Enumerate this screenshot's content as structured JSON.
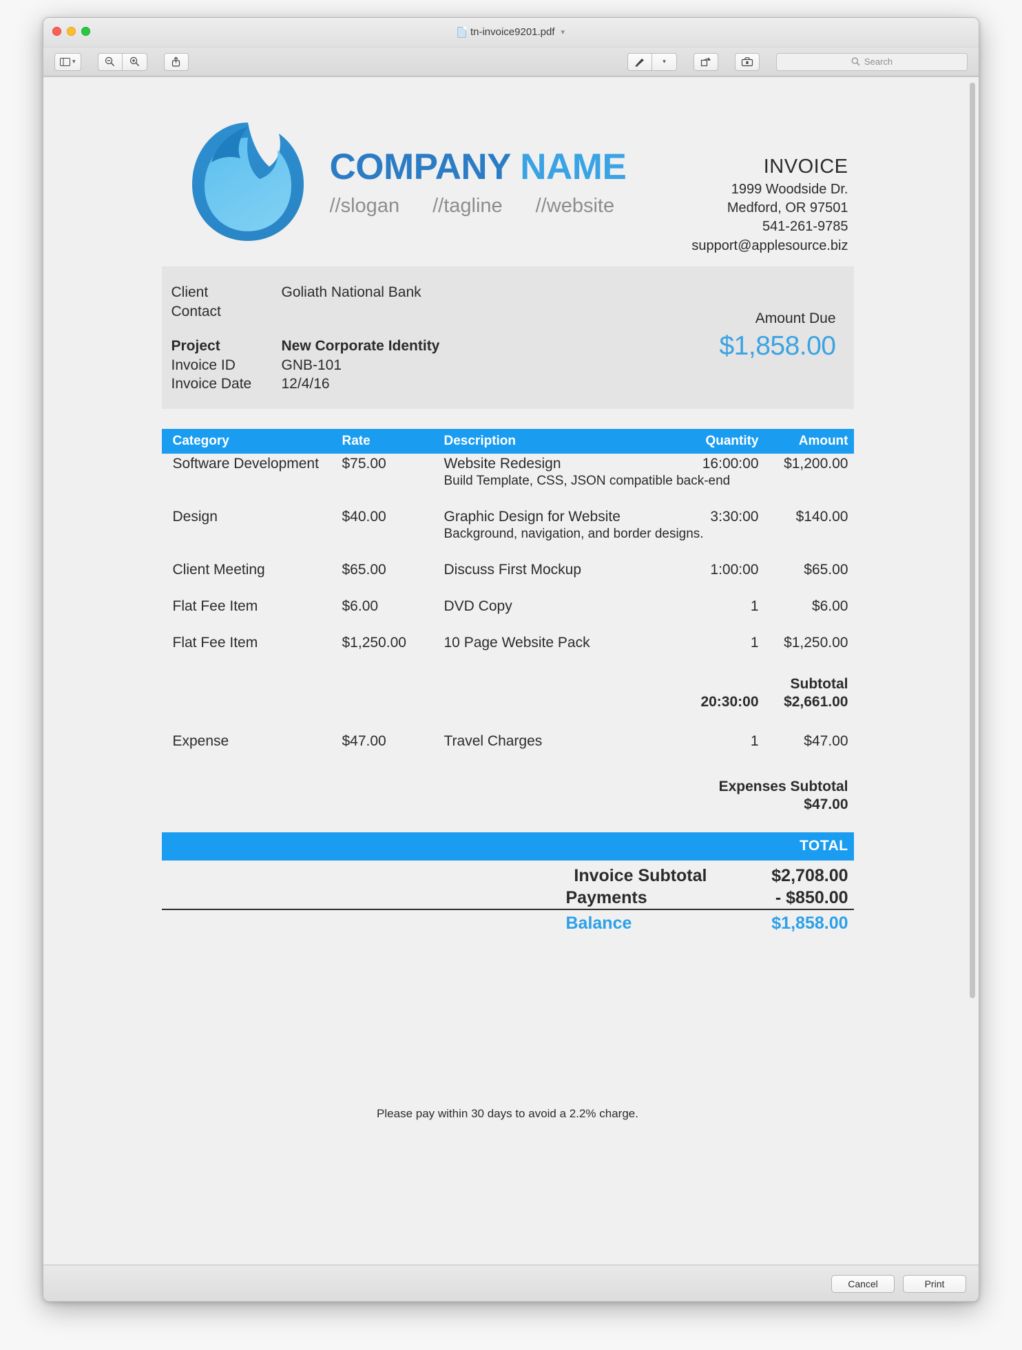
{
  "window": {
    "title": "tn-invoice9201.pdf",
    "traffic_lights": [
      "close",
      "minimize",
      "zoom"
    ]
  },
  "toolbar": {
    "sidebar_icon": "sidebar-icon",
    "zoom_out_icon": "zoom-out-icon",
    "zoom_in_icon": "zoom-in-icon",
    "share_icon": "share-icon",
    "markup_icon": "markup-pen-icon",
    "rotate_icon": "rotate-icon",
    "toolbox_icon": "markup-toolbox-icon",
    "search_placeholder": "Search"
  },
  "invoice": {
    "brand": {
      "name_part1": "COMPANY",
      "name_part2": "NAME",
      "slogan": "//slogan",
      "tagline": "//tagline",
      "website": "//website"
    },
    "heading": "INVOICE",
    "address_lines": [
      "1999 Woodside Dr.",
      "Medford, OR 97501",
      "541-261-9785",
      "support@applesource.biz"
    ],
    "client_block": {
      "label_client": "Client",
      "label_contact": "Contact",
      "label_project": "Project",
      "label_invoice_id": "Invoice ID",
      "label_invoice_date": "Invoice Date",
      "value_client": "Goliath National Bank",
      "value_contact": "",
      "value_project": "New Corporate Identity",
      "value_invoice_id": "GNB-101",
      "value_invoice_date": "12/4/16",
      "amount_due_label": "Amount Due",
      "amount_due_value": "$1,858.00"
    },
    "table": {
      "headers": {
        "category": "Category",
        "rate": "Rate",
        "description": "Description",
        "quantity": "Quantity",
        "amount": "Amount"
      },
      "rows": [
        {
          "category": "Software Development",
          "rate": "$75.00",
          "description": "Website Redesign",
          "sub_description": "Build Template, CSS, JSON compatible back-end",
          "quantity": "16:00:00",
          "amount": "$1,200.00"
        },
        {
          "category": "Design",
          "rate": "$40.00",
          "description": "Graphic Design for Website",
          "sub_description": "Background, navigation, and border designs.",
          "quantity": "3:30:00",
          "amount": "$140.00"
        },
        {
          "category": "Client Meeting",
          "rate": "$65.00",
          "description": "Discuss First Mockup",
          "sub_description": "",
          "quantity": "1:00:00",
          "amount": "$65.00"
        },
        {
          "category": "Flat Fee Item",
          "rate": "$6.00",
          "description": "DVD Copy",
          "sub_description": "",
          "quantity": "1",
          "amount": "$6.00"
        },
        {
          "category": "Flat Fee Item",
          "rate": "$1,250.00",
          "description": "10 Page Website Pack",
          "sub_description": "",
          "quantity": "1",
          "amount": "$1,250.00"
        }
      ],
      "subtotal": {
        "label": "Subtotal",
        "quantity": "20:30:00",
        "amount": "$2,661.00"
      },
      "expense_row": {
        "category": "Expense",
        "rate": "$47.00",
        "description": "Travel Charges",
        "quantity": "1",
        "amount": "$47.00"
      },
      "expenses_subtotal": {
        "label": "Expenses Subtotal",
        "amount": "$47.00"
      }
    },
    "totals": {
      "total_bar_label": "TOTAL",
      "invoice_subtotal_label": "Invoice Subtotal",
      "invoice_subtotal_value": "$2,708.00",
      "payments_label": "Payments",
      "payments_value": "- $850.00",
      "balance_label": "Balance",
      "balance_value": "$1,858.00"
    },
    "footer_note": "Please pay within 30 days to avoid a 2.2% charge."
  },
  "bottom_bar": {
    "cancel_label": "Cancel",
    "print_label": "Print"
  },
  "colors": {
    "accent_blue": "#1a9cf0",
    "brand_dark_blue": "#2b7cc4",
    "brand_light_blue": "#3aa3e3",
    "strip_gray": "#e4e4e4"
  }
}
